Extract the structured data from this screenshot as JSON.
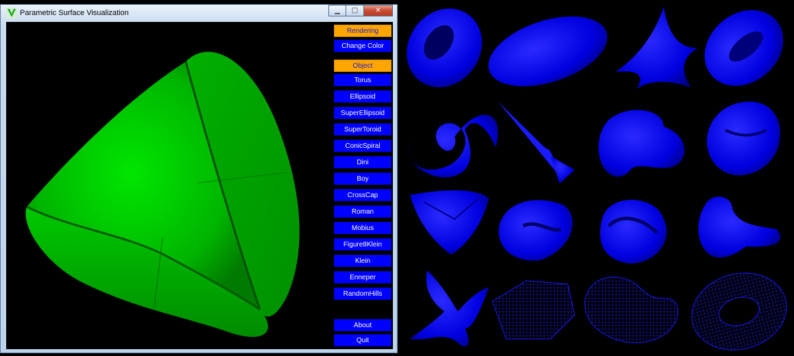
{
  "window": {
    "title": "Parametric Surface Visualization",
    "controls": {
      "minimize": "▁",
      "maximize": "□",
      "close": "✕"
    }
  },
  "menu": {
    "rendering_header": "Rendering",
    "change_color": "Change Color",
    "object_header": "Object",
    "objects": [
      "Torus",
      "Ellipsoid",
      "SuperEllipsoid",
      "SuperToroid",
      "ConicSpiral",
      "Dini",
      "Boy",
      "CrossCap",
      "Roman",
      "Mobius",
      "Figure8Klein",
      "Klein",
      "Enneper",
      "RandomHills"
    ],
    "about": "About",
    "quit": "Quit"
  },
  "colors": {
    "surface_green": "#00cc00",
    "gallery_blue": "#1010ff",
    "menu_button": "#0000ff",
    "menu_header": "#ffa500"
  },
  "gallery": {
    "surfaces": [
      "torus",
      "ellipsoid",
      "super-ellipsoid",
      "super-toroid",
      "conic-spiral",
      "dini",
      "boy",
      "cross-cap",
      "roman",
      "mobius",
      "figure8-klein",
      "klein",
      "enneper",
      "random-hills",
      "mobius-wireframe",
      "torus-wireframe"
    ]
  }
}
